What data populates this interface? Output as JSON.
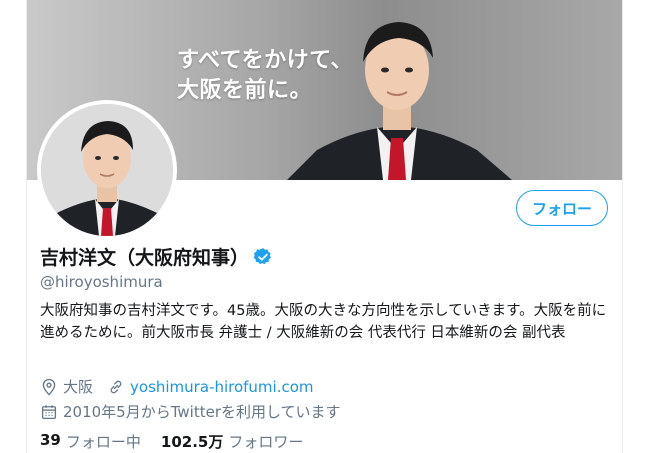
{
  "banner": {
    "line1": "すべてをかけて、",
    "line2": "大阪を前に。"
  },
  "profile": {
    "display_name": "吉村洋文（大阪府知事）",
    "handle": "@hiroyoshimura",
    "bio": "大阪府知事の吉村洋文です。45歳。大阪の大きな方向性を示していきます。大阪を前に進めるために。前大阪市長 弁護士 / 大阪維新の会 代表代行 日本維新の会 副代表",
    "location": "大阪",
    "website": "yoshimura-hirofumi.com",
    "joined": "2010年5月からTwitterを利用しています"
  },
  "actions": {
    "follow_label": "フォロー"
  },
  "stats": {
    "following_count": "39",
    "following_label": "フォロー中",
    "followers_count": "102.5万",
    "followers_label": "フォロワー"
  },
  "colors": {
    "accent": "#1da1f2",
    "link": "#1b95e0",
    "secondary_text": "#657786",
    "primary_text": "#14171a"
  },
  "icons": {
    "verified": "verified-badge-icon",
    "location": "location-pin-icon",
    "website": "link-icon",
    "joined": "calendar-icon"
  }
}
